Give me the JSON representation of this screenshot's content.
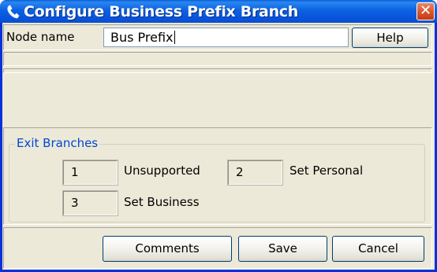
{
  "window": {
    "title": "Configure Business Prefix Branch",
    "title_icon": "phone-handset-icon",
    "close_icon": "close-icon",
    "close_glyph": "✕"
  },
  "node": {
    "label": "Node name",
    "value": "Bus Prefix",
    "help_label": "Help"
  },
  "exit_branches": {
    "legend": "Exit Branches",
    "items": [
      {
        "number": "1",
        "label": "Unsupported"
      },
      {
        "number": "2",
        "label": "Set Personal"
      },
      {
        "number": "3",
        "label": "Set Business"
      }
    ]
  },
  "buttons": {
    "comments": "Comments",
    "save": "Save",
    "cancel": "Cancel"
  },
  "colors": {
    "title_bar": "#0a5fd6",
    "window_face": "#ece9d8",
    "close_button": "#d85a32",
    "legend_text": "#0046d5"
  }
}
